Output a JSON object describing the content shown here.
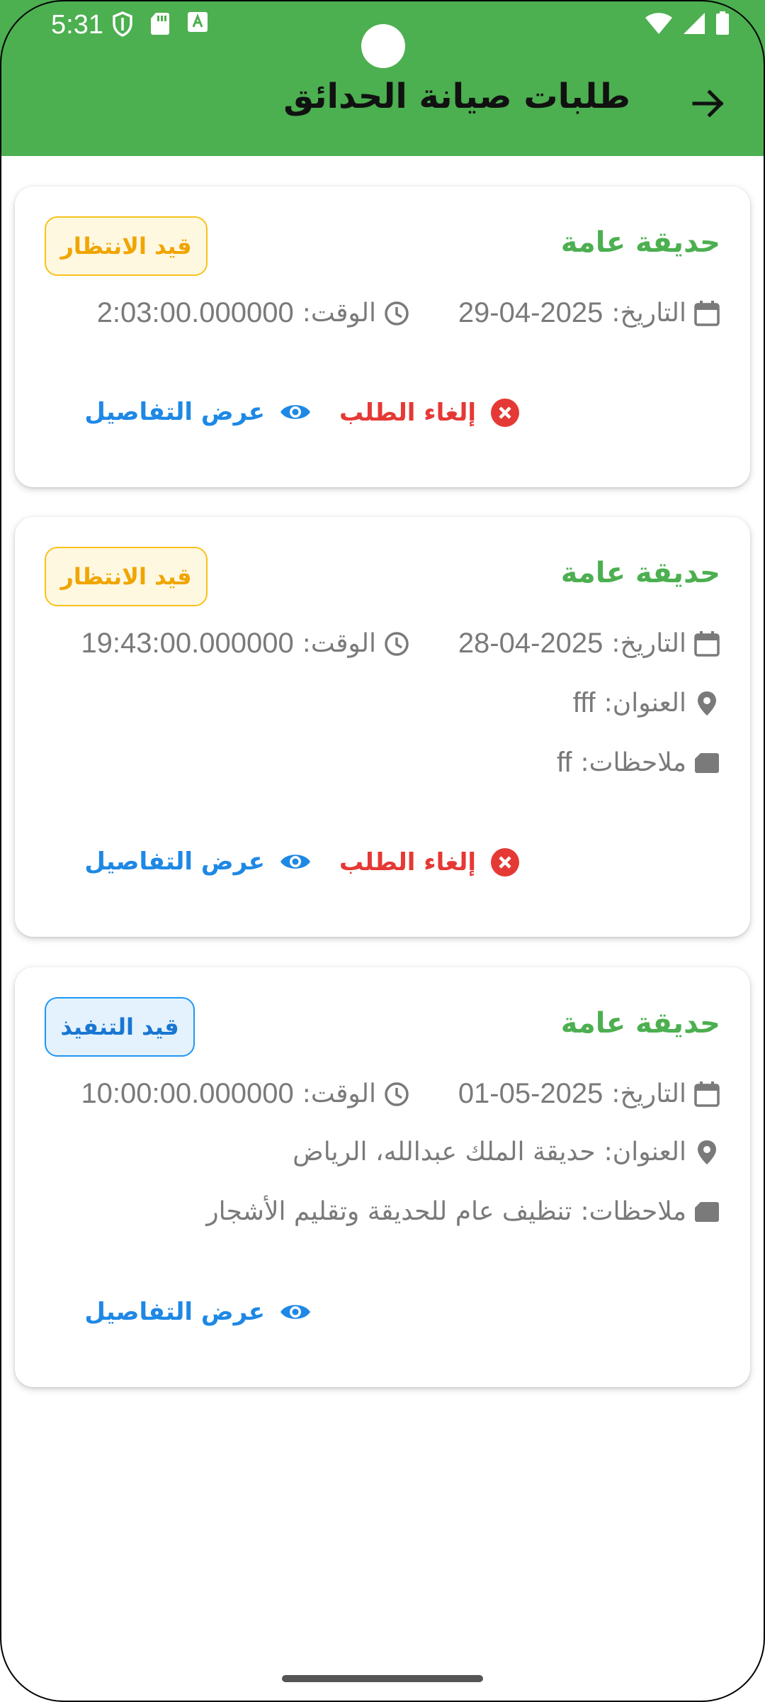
{
  "status_bar": {
    "time": "5:31"
  },
  "header": {
    "title": "طلبات صيانة الحدائق"
  },
  "labels": {
    "date": "التاريخ:",
    "time": "الوقت:",
    "address": "العنوان:",
    "notes": "ملاحظات:",
    "cancel": "إلغاء الطلب",
    "details": "عرض التفاصيل"
  },
  "requests": [
    {
      "title": "حديقة عامة",
      "status": "قيد الانتظار",
      "date": "29-04-2025",
      "time": "2:03:00.000000"
    },
    {
      "title": "حديقة عامة",
      "status": "قيد الانتظار",
      "date": "28-04-2025",
      "time": "19:43:00.000000",
      "address": "fff",
      "notes": "ff"
    },
    {
      "title": "حديقة عامة",
      "status": "قيد التنفيذ",
      "date": "01-05-2025",
      "time": "10:00:00.000000",
      "address": "حديقة الملك عبدالله، الرياض",
      "notes": "تنظيف عام للحديقة وتقليم الأشجار"
    }
  ],
  "colors": {
    "app_bar": "#4caf50",
    "title_green": "#4caf50",
    "pending": "#f0a500",
    "in_progress": "#1976d2",
    "cancel": "#e53935",
    "details": "#1e88e5"
  },
  "icons": [
    "shield-icon",
    "sd-card-icon",
    "keyboard-a-icon",
    "wifi-icon",
    "signal-icon",
    "battery-icon",
    "arrow-right-icon",
    "calendar-icon",
    "clock-icon",
    "location-pin-icon",
    "note-icon",
    "cancel-circle-icon",
    "eye-icon"
  ]
}
